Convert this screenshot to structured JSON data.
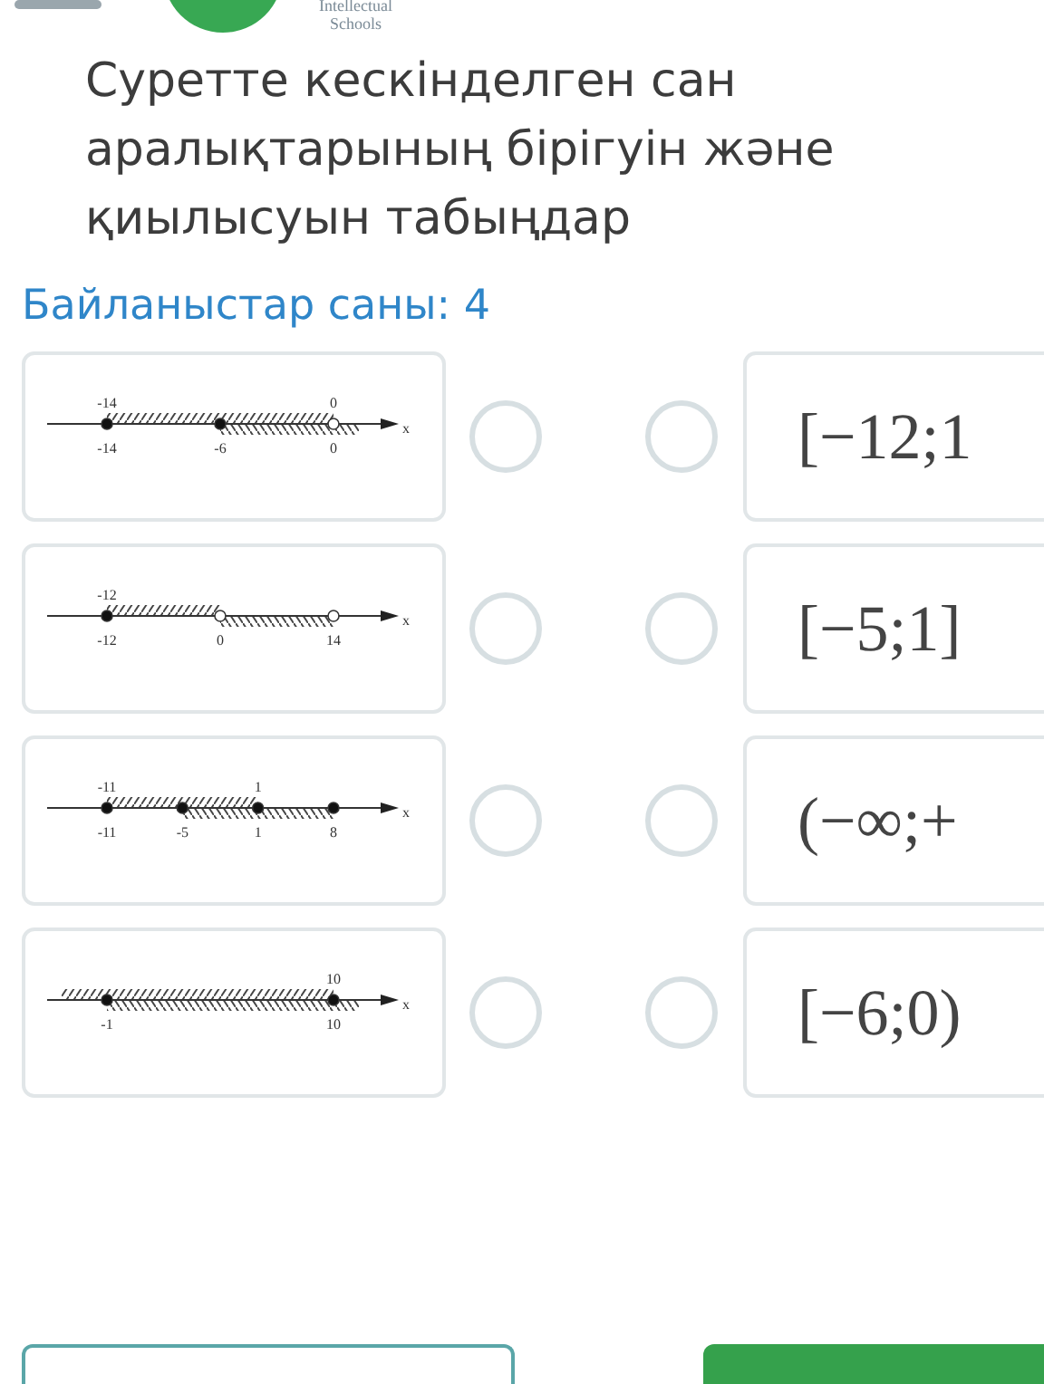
{
  "header": {
    "logo_lines": [
      "Intellectual",
      "Schools"
    ]
  },
  "question": {
    "lines": [
      "Суретте кескінделген сан",
      "аралықтарының бірігуін және",
      "қиылысуын табыңдар"
    ]
  },
  "connections_label": "Байланыстар саны: 4",
  "left_items": [
    {
      "axis_label": "x",
      "points": [
        {
          "above": "-14",
          "below": "-14",
          "filled": true
        },
        {
          "below": "-6",
          "filled": true
        },
        {
          "above": "0",
          "below": "0",
          "filled": false
        }
      ],
      "segments": [
        {
          "kind": "none"
        },
        {
          "kind": "upper"
        },
        {
          "kind": "both"
        },
        {
          "kind": "lower"
        }
      ],
      "radio_selected": false
    },
    {
      "axis_label": "x",
      "points": [
        {
          "above": "-12",
          "below": "-12",
          "filled": true
        },
        {
          "below": "0",
          "filled": false
        },
        {
          "below": "14",
          "filled": false
        }
      ],
      "segments": [
        {
          "kind": "none"
        },
        {
          "kind": "upper"
        },
        {
          "kind": "lower"
        },
        {
          "kind": "none"
        }
      ],
      "radio_selected": false
    },
    {
      "axis_label": "x",
      "points": [
        {
          "above": "-11",
          "below": "-11",
          "filled": true
        },
        {
          "below": "-5",
          "filled": true
        },
        {
          "above": "1",
          "below": "1",
          "filled": true
        },
        {
          "below": "8",
          "filled": true
        }
      ],
      "segments": [
        {
          "kind": "none"
        },
        {
          "kind": "upper"
        },
        {
          "kind": "both"
        },
        {
          "kind": "lower"
        },
        {
          "kind": "none"
        }
      ],
      "radio_selected": false
    },
    {
      "axis_label": "x",
      "points": [
        {
          "below": "-1",
          "filled": true
        },
        {
          "above": "10",
          "below": "10",
          "filled": true
        }
      ],
      "segments": [
        {
          "kind": "upper"
        },
        {
          "kind": "both"
        },
        {
          "kind": "lower"
        }
      ],
      "radio_selected": false
    }
  ],
  "right_items": [
    {
      "text": "[−12;1",
      "radio_selected": false
    },
    {
      "text": "[−5;1]",
      "radio_selected": false
    },
    {
      "text": "(−∞;+",
      "radio_selected": false
    },
    {
      "text": "[−6;0)",
      "radio_selected": false
    }
  ]
}
